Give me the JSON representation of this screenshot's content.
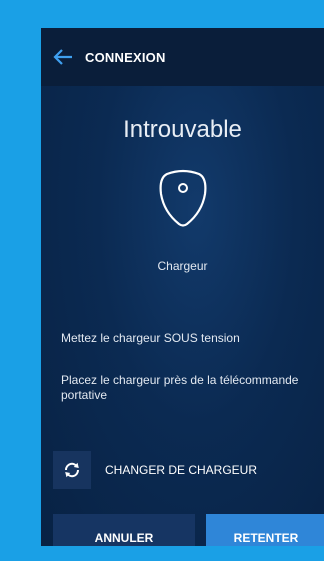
{
  "header": {
    "title": "CONNEXION",
    "back_icon": "arrow-left-icon"
  },
  "main": {
    "heading": "Introuvable",
    "device_icon": "charger-icon",
    "device_label": "Chargeur",
    "instruction_1": "Mettez le chargeur SOUS tension",
    "instruction_2": "Placez le chargeur près de la télécommande portative",
    "change_charger_icon": "refresh-icon",
    "change_charger_label": "CHANGER DE CHARGEUR"
  },
  "footer": {
    "cancel_label": "ANNULER",
    "retry_label": "RETENTER"
  },
  "colors": {
    "frame": "#1aa0e6",
    "background": "#0b2a52",
    "topbar": "#0a1e3a",
    "accent": "#2f86d8",
    "back_arrow": "#3fa0f0"
  }
}
